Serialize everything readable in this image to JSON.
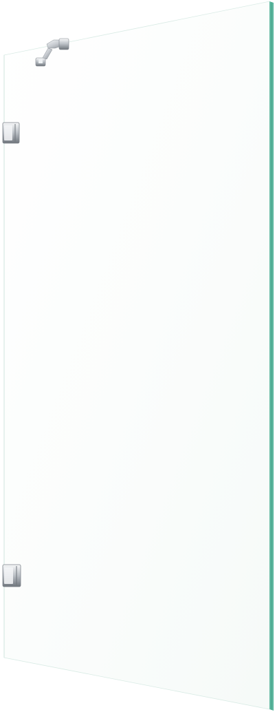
{
  "image": {
    "subject": "",
    "colors": {
      "background": "#ffffff",
      "glass_face": "#fbfdfc",
      "glass_edge": "#5fb8a0",
      "glass_edge_dark": "#3e9a83",
      "chrome_light": "#f2f4f6",
      "chrome_mid": "#c9cdd2",
      "chrome_dark": "#7d838a"
    }
  }
}
